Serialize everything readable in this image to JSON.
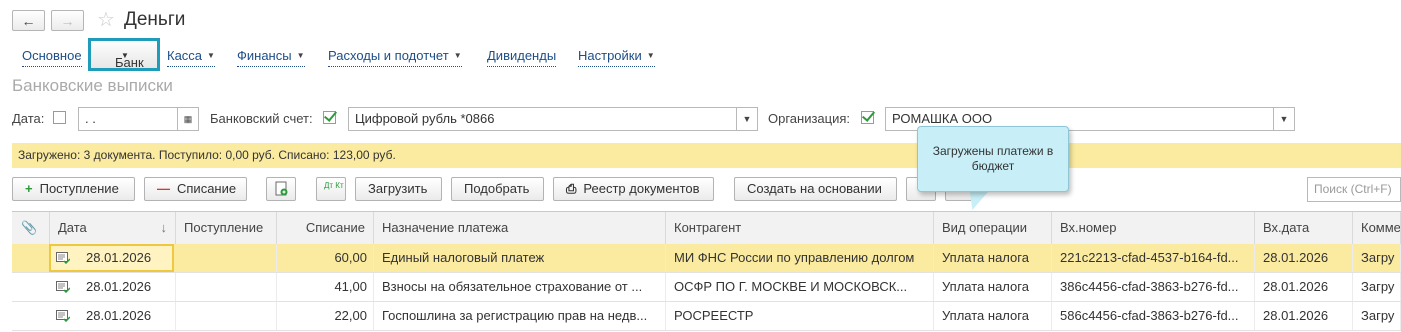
{
  "header": {
    "back_icon": "arrow-left-icon",
    "forward_icon": "arrow-right-icon",
    "star_icon": "star-icon",
    "title": "Деньги"
  },
  "menu": {
    "items": [
      {
        "label": "Основное",
        "dropdown": false
      },
      {
        "label": "Банк",
        "dropdown": true,
        "active": true
      },
      {
        "label": "Касса",
        "dropdown": true
      },
      {
        "label": "Финансы",
        "dropdown": true
      },
      {
        "label": "Расходы и подотчет",
        "dropdown": true
      },
      {
        "label": "Дивиденды",
        "dropdown": false
      },
      {
        "label": "Настройки",
        "dropdown": true
      }
    ]
  },
  "page_subtitle": "Банковские выписки",
  "filters": {
    "date_label": "Дата:",
    "date_checked": false,
    "date_value": ". .",
    "bank_account_label": "Банковский счет:",
    "bank_account_checked": true,
    "bank_account_value": "Цифровой рубль *0866",
    "organization_label": "Организация:",
    "organization_checked": true,
    "organization_value": "РОМАШКА ООО"
  },
  "status": "Загружено: 3 документа. Поступило: 0,00 руб. Списано: 123,00 руб.",
  "toolbar": {
    "receipt": "Поступление",
    "writeoff": "Списание",
    "load": "Загрузить",
    "pick": "Подобрать",
    "registry": "Реестр документов",
    "create_based": "Создать на основании",
    "search_placeholder": "Поиск (Ctrl+F)",
    "dt_kt": "Дт Кт"
  },
  "tooltip": "Загружены платежи в бюджет",
  "table": {
    "columns": [
      "Дата",
      "Поступление",
      "Списание",
      "Назначение платежа",
      "Контрагент",
      "Вид операции",
      "Вх.номер",
      "Вх.дата",
      "Комме"
    ],
    "sort_indicator": "↓",
    "rows": [
      {
        "date": "28.01.2026",
        "income": "",
        "expense": "60,00",
        "purpose": "Единый налоговый платеж",
        "counterparty": "МИ ФНС России по управлению долгом",
        "operation": "Уплата налога",
        "in_number": "221c2213-cfad-4537-b164-fd...",
        "in_date": "28.01.2026",
        "comment": "Загру"
      },
      {
        "date": "28.01.2026",
        "income": "",
        "expense": "41,00",
        "purpose": "Взносы на обязательное страхование от ...",
        "counterparty": "ОСФР ПО Г. МОСКВЕ И МОСКОВСК...",
        "operation": "Уплата налога",
        "in_number": "386c4456-cfad-3863-b276-fd...",
        "in_date": "28.01.2026",
        "comment": "Загру"
      },
      {
        "date": "28.01.2026",
        "income": "",
        "expense": "22,00",
        "purpose": "Госпошлина за регистрацию прав на недв...",
        "counterparty": "РОСРЕЕСТР",
        "operation": "Уплата налога",
        "in_number": "586c4456-cfad-3863-b276-fd...",
        "in_date": "28.01.2026",
        "comment": "Загру"
      }
    ]
  }
}
